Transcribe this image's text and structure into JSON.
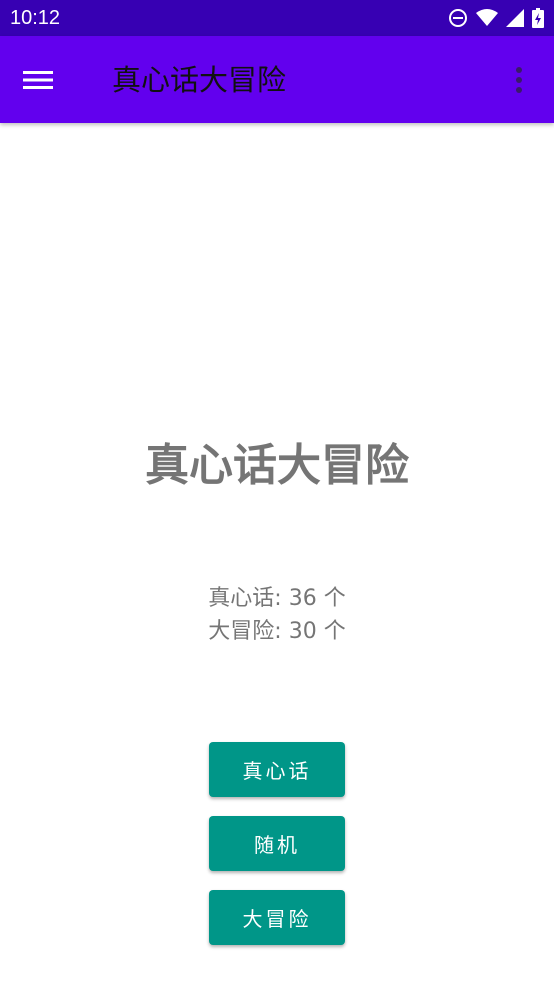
{
  "status_bar": {
    "time": "10:12",
    "icons": [
      "do-not-disturb-icon",
      "wifi-icon",
      "cell-signal-icon",
      "battery-charging-icon"
    ]
  },
  "app_bar": {
    "title": "真心话大冒险",
    "menu_icon": "hamburger-menu-icon",
    "overflow_icon": "more-vert-icon"
  },
  "main": {
    "title": "真心话大冒险",
    "truth_count_text": "真心话: 36 个",
    "dare_count_text": "大冒险: 30 个"
  },
  "buttons": {
    "truth_label": "真心话",
    "random_label": "随机",
    "dare_label": "大冒险"
  },
  "colors": {
    "status_bar": "#3700b3",
    "app_bar": "#6200ee",
    "button": "#009688",
    "text_gray": "#757575"
  }
}
